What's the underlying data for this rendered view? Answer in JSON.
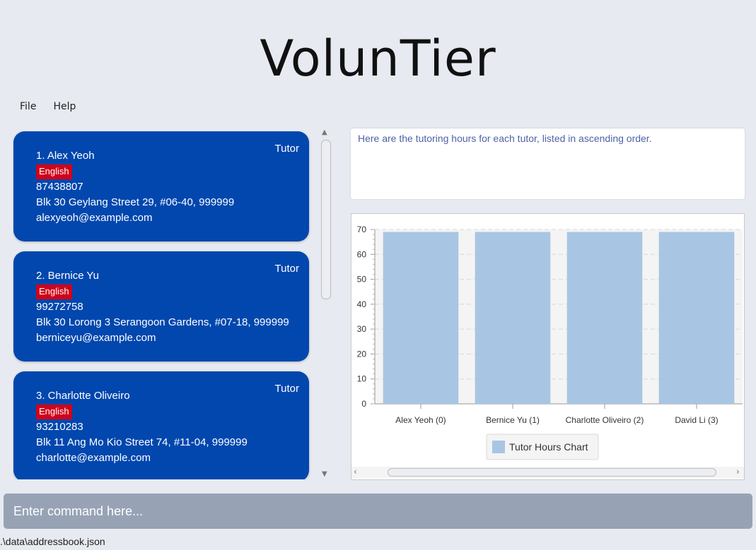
{
  "app": {
    "title": "VolunTier"
  },
  "menu": {
    "file": "File",
    "help": "Help"
  },
  "persons": [
    {
      "index_name": "1. Alex Yeoh",
      "role": "Tutor",
      "tag": "English",
      "phone": "87438807",
      "address": "Blk 30 Geylang Street 29, #06-40, 999999",
      "email": "alexyeoh@example.com"
    },
    {
      "index_name": "2. Bernice Yu",
      "role": "Tutor",
      "tag": "English",
      "phone": "99272758",
      "address": "Blk 30 Lorong 3 Serangoon Gardens, #07-18, 999999",
      "email": "berniceyu@example.com"
    },
    {
      "index_name": "3. Charlotte Oliveiro",
      "role": "Tutor",
      "tag": "English",
      "phone": "93210283",
      "address": "Blk 11 Ang Mo Kio Street 74, #11-04, 999999",
      "email": "charlotte@example.com"
    }
  ],
  "result": {
    "text": "Here are the tutoring hours for each tutor, listed in ascending order."
  },
  "chart_data": {
    "type": "bar",
    "categories": [
      "Alex Yeoh (0)",
      "Bernice Yu (1)",
      "Charlotte Oliveiro (2)",
      "David Li (3)"
    ],
    "values": [
      69,
      69,
      69,
      69
    ],
    "series": [
      {
        "name": "Tutor Hours Chart",
        "values": [
          69,
          69,
          69,
          69
        ]
      }
    ],
    "yticks": [
      0,
      10,
      20,
      30,
      40,
      50,
      60,
      70
    ],
    "ylim": [
      0,
      70
    ],
    "grid": true,
    "legend": "bottom-center",
    "bar_color": "#a8c6e3"
  },
  "command": {
    "placeholder": "Enter command here..."
  },
  "status": {
    "path": ".\\data\\addressbook.json"
  },
  "colors": {
    "card": "#0147ae",
    "tag": "#d0021b",
    "command_box": "#97a3b5",
    "background": "#e7eaf0"
  }
}
